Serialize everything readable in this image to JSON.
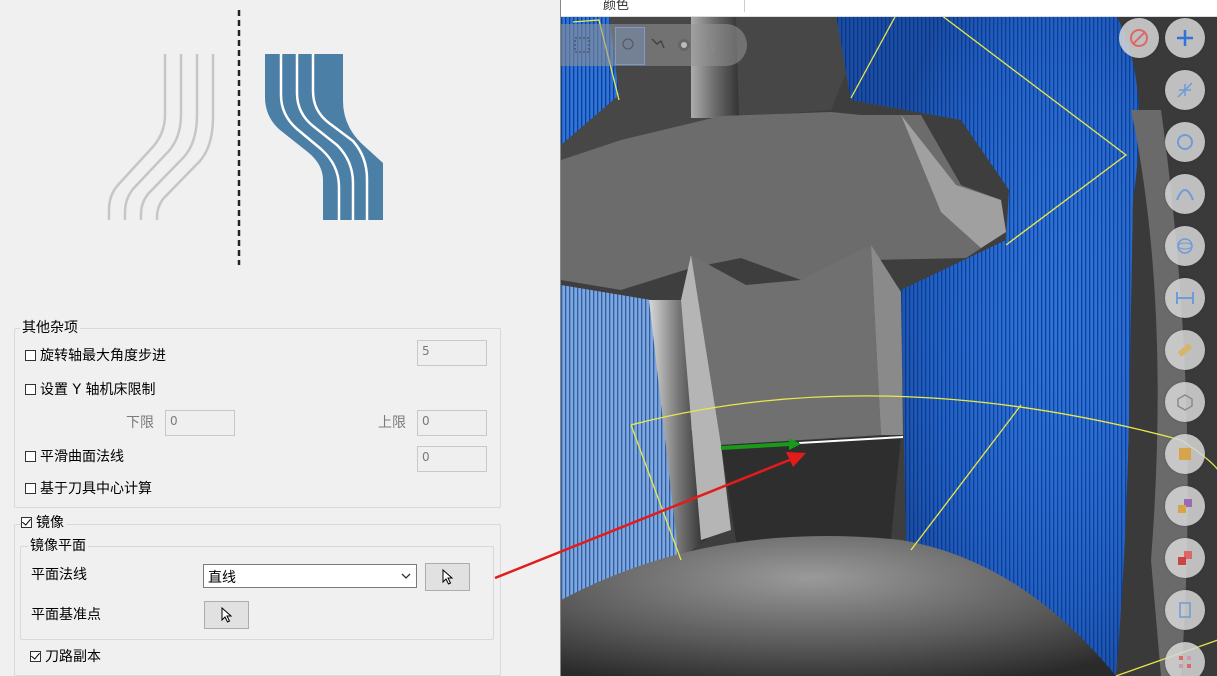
{
  "misc": {
    "title": "其他杂项",
    "max_angle_step": {
      "label": "旋转轴最大角度步进",
      "checked": false,
      "value": "5"
    },
    "y_axis_limit": {
      "label": "设置 Y 轴机床限制",
      "checked": false
    },
    "lower_limit": {
      "label": "下限",
      "value": "0"
    },
    "upper_limit": {
      "label": "上限",
      "value": "0"
    },
    "smooth_normal": {
      "label": "平滑曲面法线",
      "checked": false,
      "value": "0"
    },
    "tool_center": {
      "label": "基于刀具中心计算",
      "checked": false
    }
  },
  "mirror": {
    "title": "镜像",
    "checked": true,
    "plane": {
      "title": "镜像平面",
      "normal_label": "平面法线",
      "normal_value": "直线",
      "base_point_label": "平面基准点"
    },
    "toolpath_copy": {
      "label": "刀路副本",
      "checked": true
    }
  },
  "viewport": {
    "top_strip_label": "颜色",
    "toolbar_icons": [
      "no-entry-icon",
      "plus-icon",
      "axes-icon",
      "circle-icon",
      "curve-icon",
      "sphere-icon",
      "measure-icon",
      "ruler-icon",
      "box-icon",
      "color-icon",
      "layers-icon",
      "shape-icon",
      "clipboard-icon",
      "grid-icon"
    ],
    "selection_icons": [
      "box-select-icon",
      "lasso-icon",
      "chain-icon",
      "face-select-icon",
      "solid-select-icon",
      "cursor-icon"
    ]
  },
  "colors": {
    "toolpath_blue": "#1f6fe0",
    "illustration_blue": "#4c7fa6",
    "arrow_red": "#e31b1b",
    "vector_green": "#1a9a1a",
    "boundary_yellow": "#e8e84a"
  }
}
